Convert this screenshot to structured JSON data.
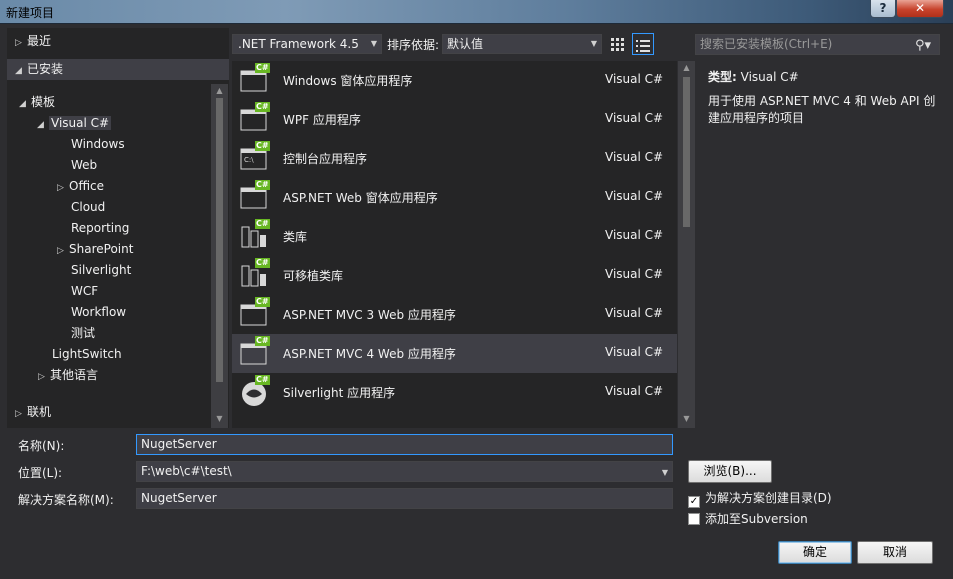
{
  "window": {
    "title": "新建项目",
    "help": "?",
    "close": "✕"
  },
  "tree": {
    "recent": "最近",
    "installed": "已安装",
    "templates": "模板",
    "visual_csharp": "Visual C#",
    "children": [
      "Windows",
      "Web",
      "Office",
      "Cloud",
      "Reporting",
      "SharePoint",
      "Silverlight",
      "WCF",
      "Workflow",
      "测试"
    ],
    "lightswitch": "LightSwitch",
    "other_langs": "其他语言",
    "online": "联机"
  },
  "toolbar": {
    "framework": ".NET Framework 4.5",
    "sort_label": "排序依据:",
    "sort_value": "默认值"
  },
  "templates": [
    {
      "name": "Windows 窗体应用程序",
      "lang": "Visual C#",
      "icon": "windows-forms-icon"
    },
    {
      "name": "WPF 应用程序",
      "lang": "Visual C#",
      "icon": "wpf-icon"
    },
    {
      "name": "控制台应用程序",
      "lang": "Visual C#",
      "icon": "console-icon",
      "glyph": "C:\\"
    },
    {
      "name": "ASP.NET Web 窗体应用程序",
      "lang": "Visual C#",
      "icon": "web-forms-icon"
    },
    {
      "name": "类库",
      "lang": "Visual C#",
      "icon": "class-library-icon"
    },
    {
      "name": "可移植类库",
      "lang": "Visual C#",
      "icon": "portable-library-icon"
    },
    {
      "name": "ASP.NET MVC 3 Web 应用程序",
      "lang": "Visual C#",
      "icon": "mvc3-icon"
    },
    {
      "name": "ASP.NET MVC 4 Web 应用程序",
      "lang": "Visual C#",
      "icon": "mvc4-icon"
    },
    {
      "name": "Silverlight 应用程序",
      "lang": "Visual C#",
      "icon": "silverlight-icon"
    }
  ],
  "search": {
    "placeholder": "搜索已安装模板(Ctrl+E)"
  },
  "details": {
    "type_label": "类型:",
    "type_value": "Visual C#",
    "description": "用于使用 ASP.NET MVC 4 和 Web API 创建应用程序的项目"
  },
  "form": {
    "name_label": "名称(N):",
    "name_value": "NugetServer",
    "location_label": "位置(L):",
    "location_value": "F:\\web\\c#\\test\\",
    "solution_label": "解决方案名称(M):",
    "solution_value": "NugetServer",
    "browse": "浏览(B)...",
    "create_dir": "为解决方案创建目录(D)",
    "create_dir_checked": true,
    "add_svn": "添加至Subversion",
    "add_svn_checked": false,
    "ok": "确定",
    "cancel": "取消"
  },
  "colors": {
    "selected_accent": "#3399ff",
    "badge_green": "#68b723"
  }
}
